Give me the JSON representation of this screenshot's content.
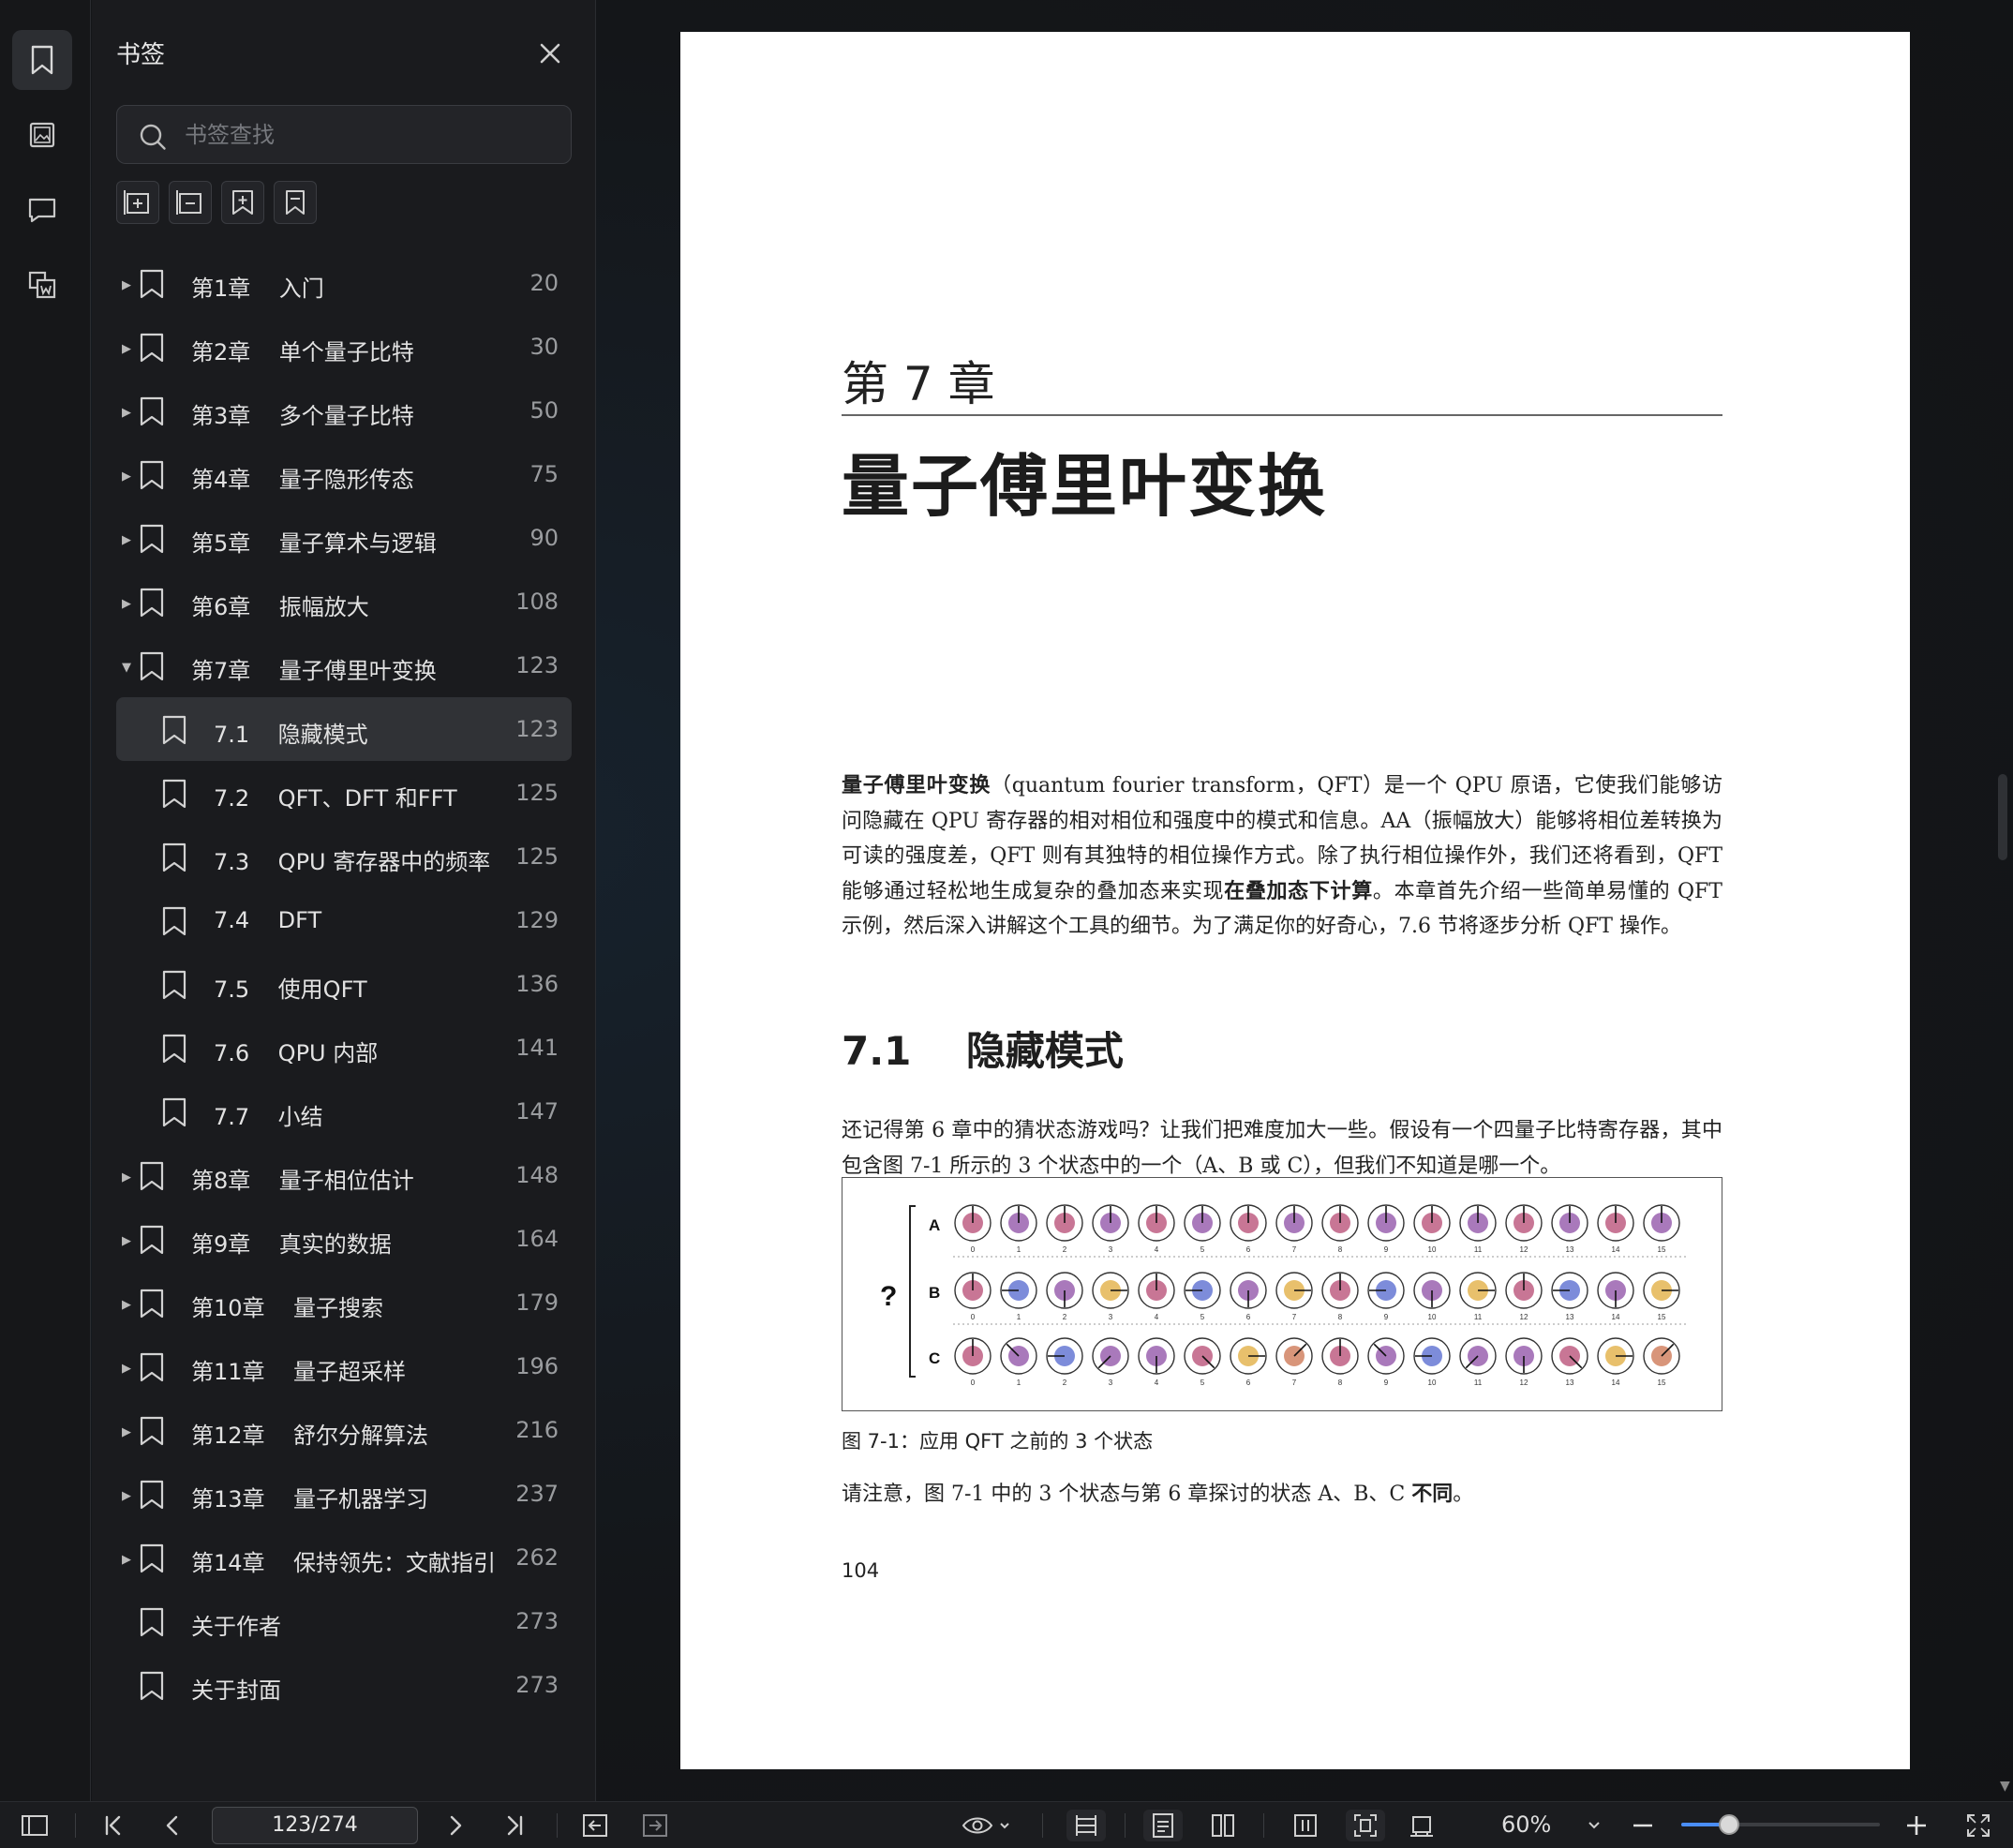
{
  "panel": {
    "title": "书签",
    "search_placeholder": "书签查找"
  },
  "bookmarks": [
    {
      "label": "第1章    入门",
      "page": "20",
      "level": 0,
      "expand": "collapsed"
    },
    {
      "label": "第2章    单个量子比特",
      "page": "30",
      "level": 0,
      "expand": "collapsed"
    },
    {
      "label": "第3章    多个量子比特",
      "page": "50",
      "level": 0,
      "expand": "collapsed"
    },
    {
      "label": "第4章    量子隐形传态",
      "page": "75",
      "level": 0,
      "expand": "collapsed"
    },
    {
      "label": "第5章    量子算术与逻辑",
      "page": "90",
      "level": 0,
      "expand": "collapsed"
    },
    {
      "label": "第6章    振幅放大",
      "page": "108",
      "level": 0,
      "expand": "collapsed"
    },
    {
      "label": "第7章    量子傅里叶变换",
      "page": "123",
      "level": 0,
      "expand": "expanded"
    },
    {
      "label": "7.1    隐藏模式",
      "page": "123",
      "level": 1,
      "expand": "none",
      "selected": true
    },
    {
      "label": "7.2    QFT、DFT 和FFT",
      "page": "125",
      "level": 1,
      "expand": "none"
    },
    {
      "label": "7.3    QPU 寄存器中的频率",
      "page": "125",
      "level": 1,
      "expand": "none"
    },
    {
      "label": "7.4    DFT",
      "page": "129",
      "level": 1,
      "expand": "none"
    },
    {
      "label": "7.5    使用QFT",
      "page": "136",
      "level": 1,
      "expand": "none"
    },
    {
      "label": "7.6    QPU 内部",
      "page": "141",
      "level": 1,
      "expand": "none"
    },
    {
      "label": "7.7    小结",
      "page": "147",
      "level": 1,
      "expand": "none"
    },
    {
      "label": "第8章    量子相位估计",
      "page": "148",
      "level": 0,
      "expand": "collapsed"
    },
    {
      "label": "第9章    真实的数据",
      "page": "164",
      "level": 0,
      "expand": "collapsed"
    },
    {
      "label": "第10章    量子搜索",
      "page": "179",
      "level": 0,
      "expand": "collapsed"
    },
    {
      "label": "第11章    量子超采样",
      "page": "196",
      "level": 0,
      "expand": "collapsed"
    },
    {
      "label": "第12章    舒尔分解算法",
      "page": "216",
      "level": 0,
      "expand": "collapsed"
    },
    {
      "label": "第13章    量子机器学习",
      "page": "237",
      "level": 0,
      "expand": "collapsed"
    },
    {
      "label": "第14章    保持领先：文献指引",
      "page": "262",
      "level": 0,
      "expand": "collapsed"
    },
    {
      "label": "关于作者",
      "page": "273",
      "level": 0,
      "expand": "none"
    },
    {
      "label": "关于封面",
      "page": "273",
      "level": 0,
      "expand": "none"
    }
  ],
  "page": {
    "chapter_label": "第 7 章",
    "chapter_title": "量子傅里叶变换",
    "intro": {
      "b1": "量子傅里叶变换",
      "t1": "（quantum fourier transform，QFT）是一个 QPU 原语，它使我们能够访问隐藏在 QPU 寄存器的相对相位和强度中的模式和信息。AA（振幅放大）能够将相位差转换为可读的强度差，QFT 则有其独特的相位操作方式。除了执行相位操作外，我们还将看到，QFT 能够通过轻松地生成复杂的叠加态来实现",
      "b2": "在叠加态下计算",
      "t2": "。本章首先介绍一些简单易懂的 QFT 示例，然后深入讲解这个工具的细节。为了满足你的好奇心，7.6 节将逐步分析 QFT 操作。"
    },
    "section_number": "7.1",
    "section_title": "隐藏模式",
    "para2": "还记得第 6 章中的猜状态游戏吗？让我们把难度加大一些。假设有一个四量子比特寄存器，其中包含图 7-1 所示的 3 个状态中的一个（A、B 或 C），但我们不知道是哪一个。",
    "figure": {
      "question_mark": "?",
      "rows": [
        "A",
        "B",
        "C"
      ],
      "index_labels": [
        "0",
        "1",
        "2",
        "3",
        "4",
        "5",
        "6",
        "7",
        "8",
        "9",
        "10",
        "11",
        "12",
        "13",
        "14",
        "15"
      ]
    },
    "caption": "图 7-1：应用 QFT 之前的 3 个状态",
    "para3_a": "请注意，图 7-1 中的 3 个状态与第 6 章探讨的状态 A、B、C ",
    "para3_b": "不同",
    "para3_c": "。",
    "page_number": "104"
  },
  "toolbar": {
    "page_indicator": "123/274",
    "zoom": "60%",
    "zoom_slider_fraction": 0.24
  },
  "colors": {
    "accent": "#4a8df8",
    "qubit_purple": "#a06ab4",
    "qubit_pink": "#c2678a",
    "qubit_blue": "#6f7fd6",
    "qubit_yellow": "#e5b95c",
    "qubit_orange": "#d48a6c"
  }
}
